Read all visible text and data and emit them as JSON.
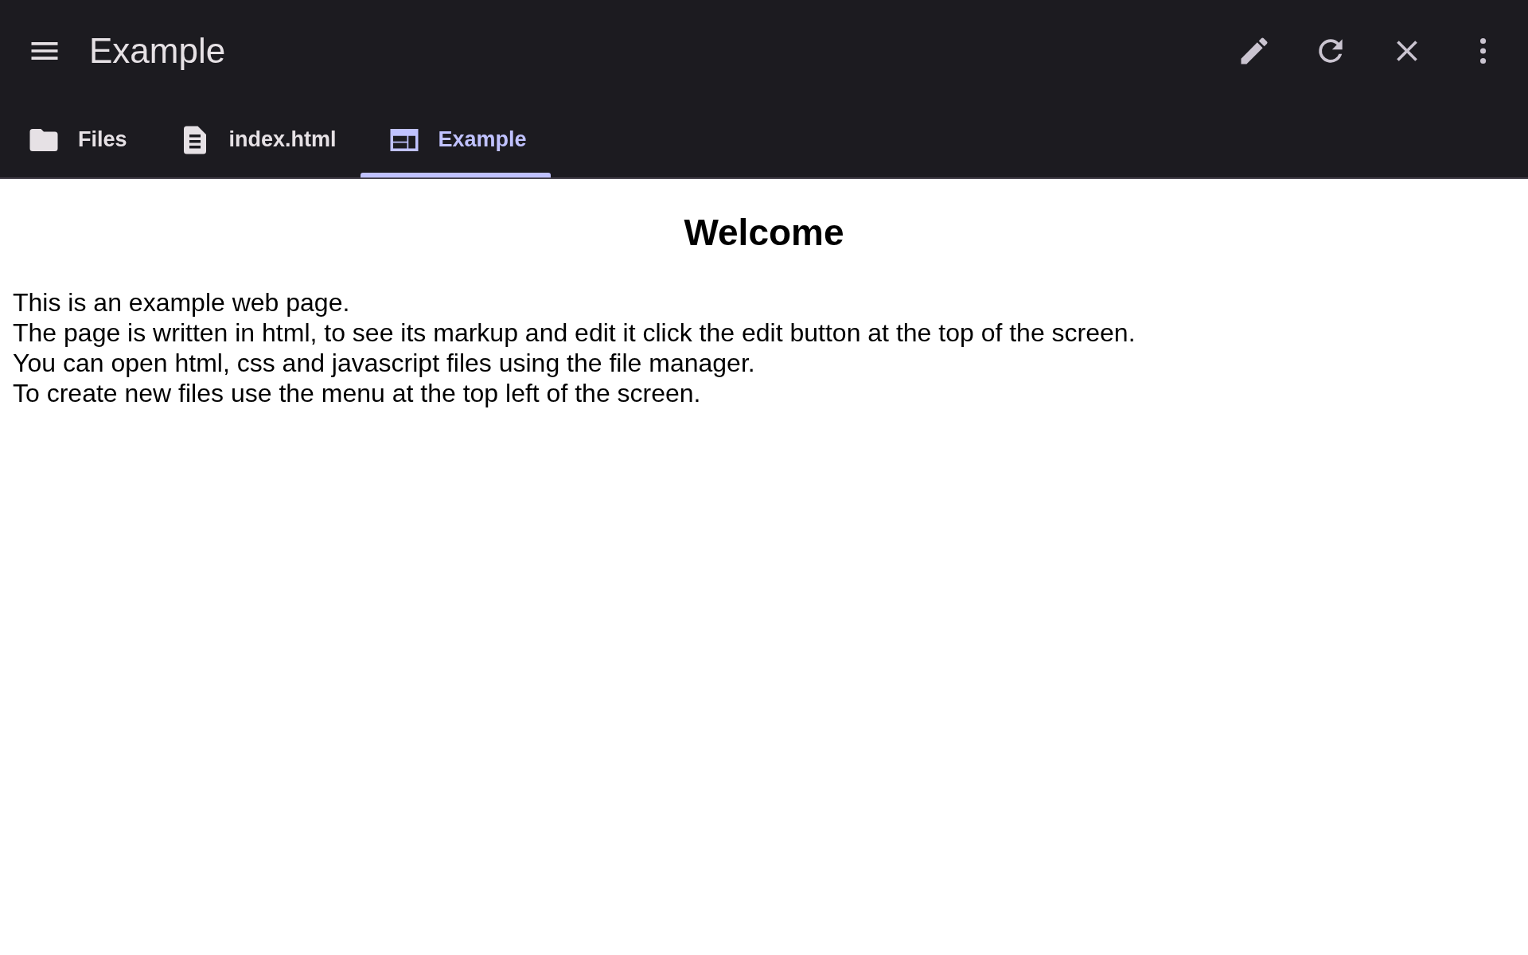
{
  "app_bar": {
    "title": "Example",
    "actions": [
      {
        "kind": "edit"
      },
      {
        "kind": "reload"
      },
      {
        "kind": "close"
      },
      {
        "kind": "more"
      }
    ]
  },
  "tabs": [
    {
      "label": "Files",
      "kind": "folder",
      "selected": false
    },
    {
      "label": "index.html",
      "kind": "document",
      "selected": false
    },
    {
      "label": "Example",
      "kind": "preview",
      "selected": true
    }
  ],
  "page": {
    "heading": "Welcome",
    "lines": [
      "This is an example web page.",
      "The page is written in html, to see its markup and edit it click the edit button at the top of the screen.",
      "You can open html, css and javascript files using the file manager.",
      "To create new files use the menu at the top left of the screen."
    ]
  }
}
